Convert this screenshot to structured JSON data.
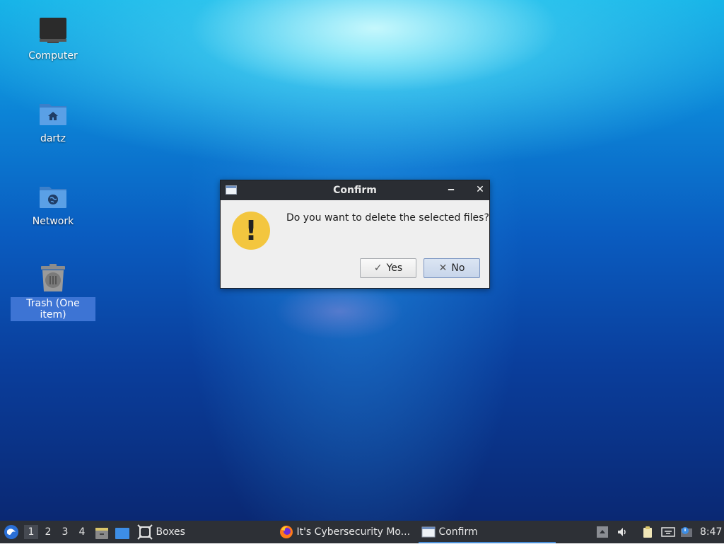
{
  "desktop": {
    "icons": [
      {
        "label": "Computer",
        "icon": "computer-icon"
      },
      {
        "label": "dartz",
        "icon": "home-folder-icon"
      },
      {
        "label": "Network",
        "icon": "network-folder-icon"
      },
      {
        "label": "Trash (One item)",
        "icon": "trash-icon",
        "selected": true
      }
    ]
  },
  "dialog": {
    "title": "Confirm",
    "minimize_glyph": "‒",
    "close_glyph": "✕",
    "message": "Do you want to delete the selected files?",
    "warning_glyph": "!",
    "yes_label": "Yes",
    "yes_glyph": "✓",
    "no_label": "No",
    "no_glyph": "✕"
  },
  "taskbar": {
    "workspaces": [
      "1",
      "2",
      "3",
      "4"
    ],
    "active_workspace": "1",
    "tasks": [
      {
        "label": "Boxes",
        "icon": "boxes-icon"
      },
      {
        "label": "It's Cybersecurity Mo...",
        "icon": "firefox-icon"
      },
      {
        "label": "Confirm",
        "icon": "window-icon",
        "active": true
      }
    ],
    "clock": "8:47"
  },
  "colors": {
    "accent": "#3d74d4",
    "titlebar": "#2a2d33",
    "taskbar": "#2d3036",
    "warning": "#f3c63f"
  }
}
